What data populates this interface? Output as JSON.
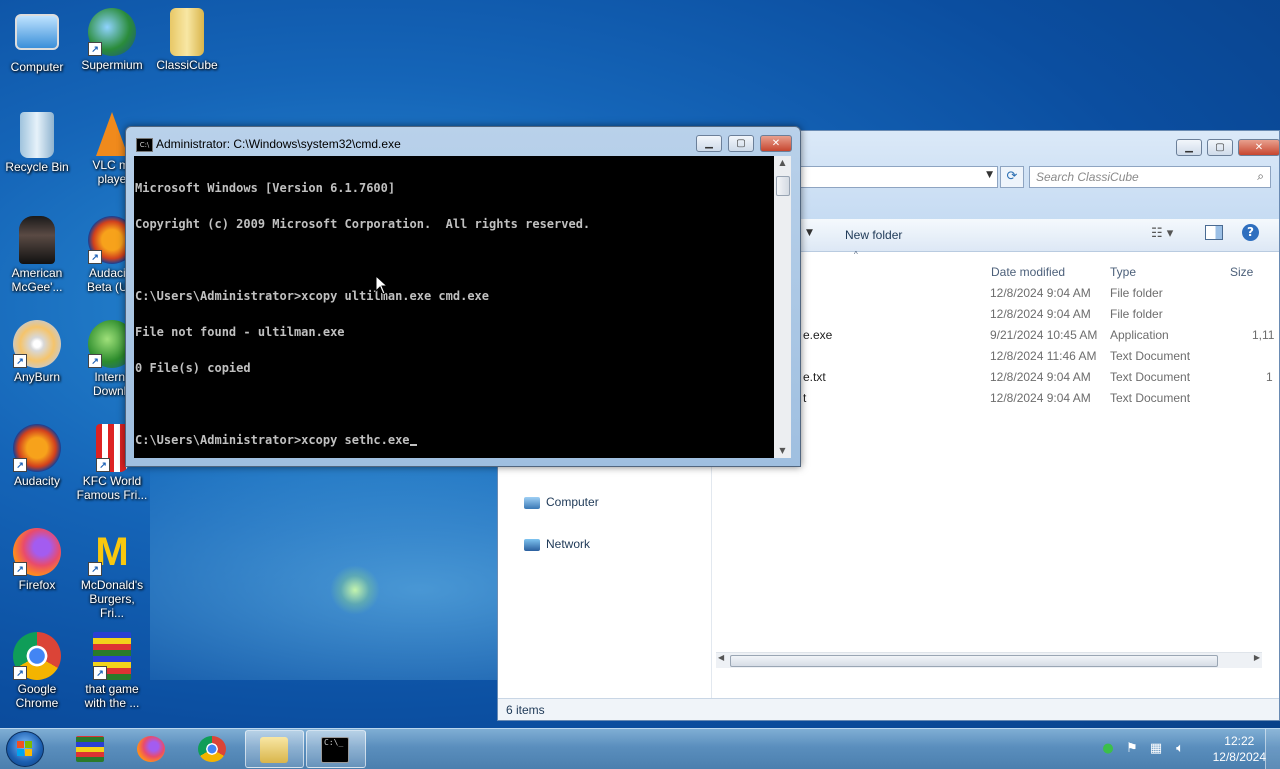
{
  "desktop": {
    "icons": [
      {
        "label": "Computer"
      },
      {
        "label": "Supermium"
      },
      {
        "label": "ClassiCube"
      },
      {
        "label": "Recycle Bin"
      },
      {
        "label": "VLC me player"
      },
      {
        "label": "American McGee'..."
      },
      {
        "label": "Audacity Beta (Uni"
      },
      {
        "label": "AnyBurn"
      },
      {
        "label": "Interne Downlo"
      },
      {
        "label": "Audacity"
      },
      {
        "label": "KFC World Famous Fri..."
      },
      {
        "label": "Firefox"
      },
      {
        "label": "McDonald's Burgers, Fri..."
      },
      {
        "label": "Google Chrome"
      },
      {
        "label": "that game with the ..."
      }
    ]
  },
  "cmd": {
    "title": "Administrator: C:\\Windows\\system32\\cmd.exe",
    "lines": [
      "Microsoft Windows [Version 6.1.7600]",
      "Copyright (c) 2009 Microsoft Corporation.  All rights reserved.",
      "",
      "C:\\Users\\Administrator>xcopy ultilman.exe cmd.exe",
      "File not found - ultilman.exe",
      "0 File(s) copied",
      "",
      "C:\\Users\\Administrator>xcopy sethc.exe"
    ]
  },
  "explorer": {
    "search_placeholder": "Search ClassiCube",
    "new_folder": "New folder",
    "columns": {
      "date": "Date modified",
      "type": "Type",
      "size": "Size"
    },
    "rows": [
      {
        "name": "",
        "date": "12/8/2024 9:04 AM",
        "type": "File folder",
        "size": ""
      },
      {
        "name": "",
        "date": "12/8/2024 9:04 AM",
        "type": "File folder",
        "size": ""
      },
      {
        "name": "e.exe",
        "date": "9/21/2024 10:45 AM",
        "type": "Application",
        "size": "1,11"
      },
      {
        "name": "",
        "date": "12/8/2024 11:46 AM",
        "type": "Text Document",
        "size": ""
      },
      {
        "name": "e.txt",
        "date": "12/8/2024 9:04 AM",
        "type": "Text Document",
        "size": "1"
      },
      {
        "name": "t",
        "date": "12/8/2024 9:04 AM",
        "type": "Text Document",
        "size": ""
      }
    ],
    "nav": [
      {
        "label": "Computer"
      },
      {
        "label": "Network"
      }
    ],
    "status": "6 items"
  },
  "taskbar": {
    "time": "12:22",
    "date": "12/8/2024"
  }
}
